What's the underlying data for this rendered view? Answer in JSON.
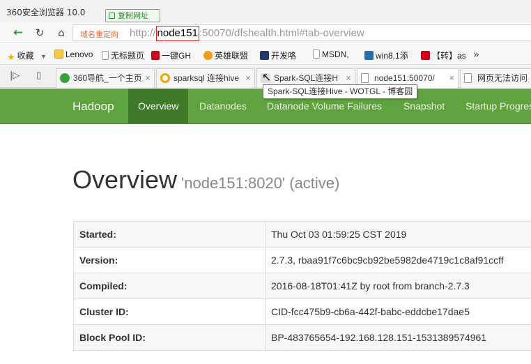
{
  "browser": {
    "title": "360安全浏览器 10.0",
    "copy_url_label": "复制网址",
    "redirect_label": "域名重定向",
    "url_prefix": "http://",
    "url_host": "node151",
    "url_rest": ":50070/dfshealth.html#tab-overview",
    "bookmarks": [
      {
        "label": "收藏",
        "icon": "star-icon"
      },
      {
        "label": "Lenovo",
        "icon": "folder-icon"
      },
      {
        "label": "无标题页",
        "icon": "page-icon"
      },
      {
        "label": "一键GH",
        "icon": "site-icon"
      },
      {
        "label": "英雄联盟",
        "icon": "game-icon"
      },
      {
        "label": "开发咯",
        "icon": "site-icon"
      },
      {
        "label": "MSDN,",
        "icon": "page-icon"
      },
      {
        "label": "win8.1添",
        "icon": "site-icon"
      },
      {
        "label": "【转】as",
        "icon": "site-icon"
      }
    ],
    "tabs": [
      {
        "label": "360导航_一个主页",
        "icon": "360-icon",
        "active": false
      },
      {
        "label": "sparksql 连接hive",
        "icon": "search-icon",
        "active": false
      },
      {
        "label": "Spark-SQL连接H",
        "icon": "site-icon",
        "active": false
      },
      {
        "label": "node151:50070/",
        "icon": "page-icon",
        "active": true
      },
      {
        "label": "网页无法访问",
        "icon": "page-icon",
        "active": false
      }
    ],
    "tooltip": "Spark-SQL连接Hive - WOTGL - 博客园"
  },
  "hadoop": {
    "brand": "Hadoop",
    "nav": [
      {
        "label": "Overview",
        "active": true
      },
      {
        "label": "Datanodes",
        "active": false
      },
      {
        "label": "Datanode Volume Failures",
        "active": false
      },
      {
        "label": "Snapshot",
        "active": false
      },
      {
        "label": "Startup Progress",
        "active": false
      }
    ],
    "title": "Overview",
    "subtitle": "'node151:8020' (active)",
    "info": [
      {
        "key": "Started:",
        "value": "Thu Oct 03 01:59:25 CST 2019"
      },
      {
        "key": "Version:",
        "value": "2.7.3, rbaa91f7c6bc9cb92be5982de4719c1c8af91ccff"
      },
      {
        "key": "Compiled:",
        "value": "2016-08-18T01:41Z by root from branch-2.7.3"
      },
      {
        "key": "Cluster ID:",
        "value": "CID-fcc475b9-cb6a-442f-babc-eddcbe17dae5"
      },
      {
        "key": "Block Pool ID:",
        "value": "BP-483765654-192.168.128.151-1531389574961"
      }
    ]
  },
  "colors": {
    "hadoop_green": "#5fa33e",
    "hadoop_active": "#3e7a2a",
    "highlight_red": "#e02020"
  }
}
